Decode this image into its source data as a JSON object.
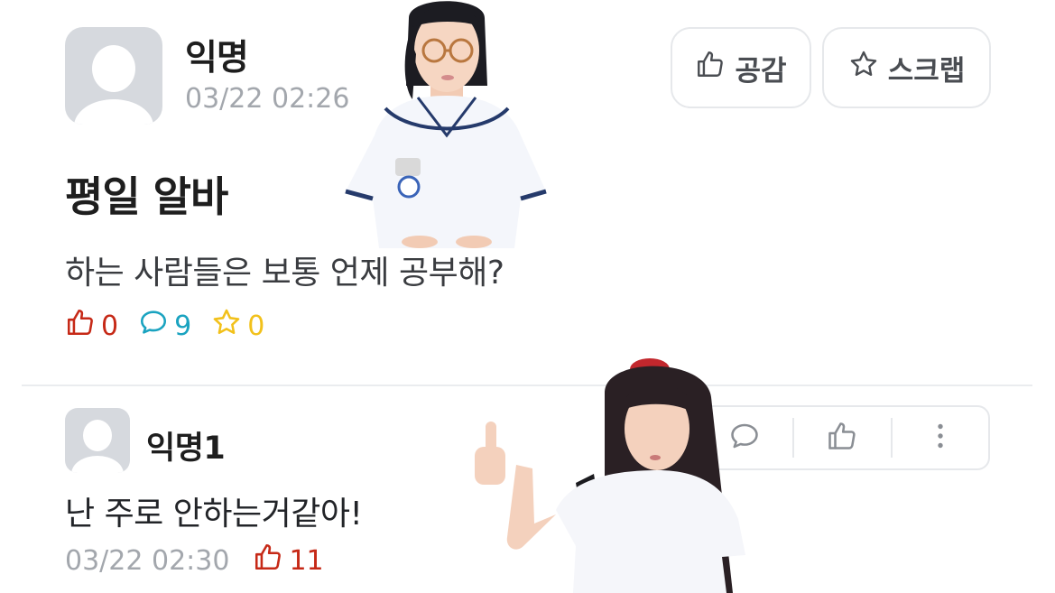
{
  "post": {
    "author": "익명",
    "timestamp": "03/22 02:26",
    "title": "평일 알바",
    "body": "하는 사람들은 보통 언제 공부해?",
    "stats": {
      "likes": "0",
      "comments": "9",
      "scraps": "0"
    }
  },
  "header_buttons": {
    "like_label": "공감",
    "scrap_label": "스크랩"
  },
  "comment": {
    "author": "익명1",
    "text": "난 주로 안하는거같아!",
    "timestamp": "03/22 02:30",
    "likes": "11"
  },
  "icons": {
    "like": "thumbs-up-icon",
    "comment": "speech-bubble-icon",
    "scrap": "star-icon",
    "more": "vertical-dots-icon"
  },
  "colors": {
    "like": "#c62917",
    "comment": "#1aa3c0",
    "scrap": "#f2c11b",
    "meta_gray": "#a3a7ad"
  }
}
